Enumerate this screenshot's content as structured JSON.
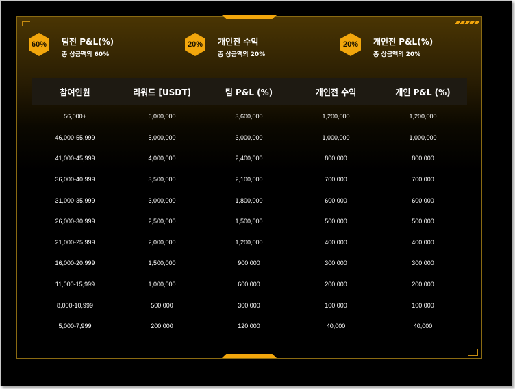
{
  "colors": {
    "accent": "#f2a60c",
    "background": "#000000",
    "header_bg": "#1e1a12"
  },
  "stats": [
    {
      "badge": "60%",
      "title": "팀전 P&L(%)",
      "subtitle": "총 상금액의 60%"
    },
    {
      "badge": "20%",
      "title": "개인전 수익",
      "subtitle": "총 상금액의 20%"
    },
    {
      "badge": "20%",
      "title": "개인전 P&L(%)",
      "subtitle": "총 상금액의 20%"
    }
  ],
  "table": {
    "headers": [
      "참여인원",
      "리워드 [USDT]",
      "팀 P&L (%)",
      "개인전 수익",
      "개인 P&L (%)"
    ],
    "rows": [
      [
        "56,000+",
        "6,000,000",
        "3,600,000",
        "1,200,000",
        "1,200,000"
      ],
      [
        "46,000-55,999",
        "5,000,000",
        "3,000,000",
        "1,000,000",
        "1,000,000"
      ],
      [
        "41,000-45,999",
        "4,000,000",
        "2,400,000",
        "800,000",
        "800,000"
      ],
      [
        "36,000-40,999",
        "3,500,000",
        "2,100,000",
        "700,000",
        "700,000"
      ],
      [
        "31,000-35,999",
        "3,000,000",
        "1,800,000",
        "600,000",
        "600,000"
      ],
      [
        "26,000-30,999",
        "2,500,000",
        "1,500,000",
        "500,000",
        "500,000"
      ],
      [
        "21,000-25,999",
        "2,000,000",
        "1,200,000",
        "400,000",
        "400,000"
      ],
      [
        "16,000-20,999",
        "1,500,000",
        "900,000",
        "300,000",
        "300,000"
      ],
      [
        "11,000-15,999",
        "1,000,000",
        "600,000",
        "200,000",
        "200,000"
      ],
      [
        "8,000-10,999",
        "500,000",
        "300,000",
        "100,000",
        "100,000"
      ],
      [
        "5,000-7,999",
        "200,000",
        "120,000",
        "40,000",
        "40,000"
      ]
    ]
  }
}
